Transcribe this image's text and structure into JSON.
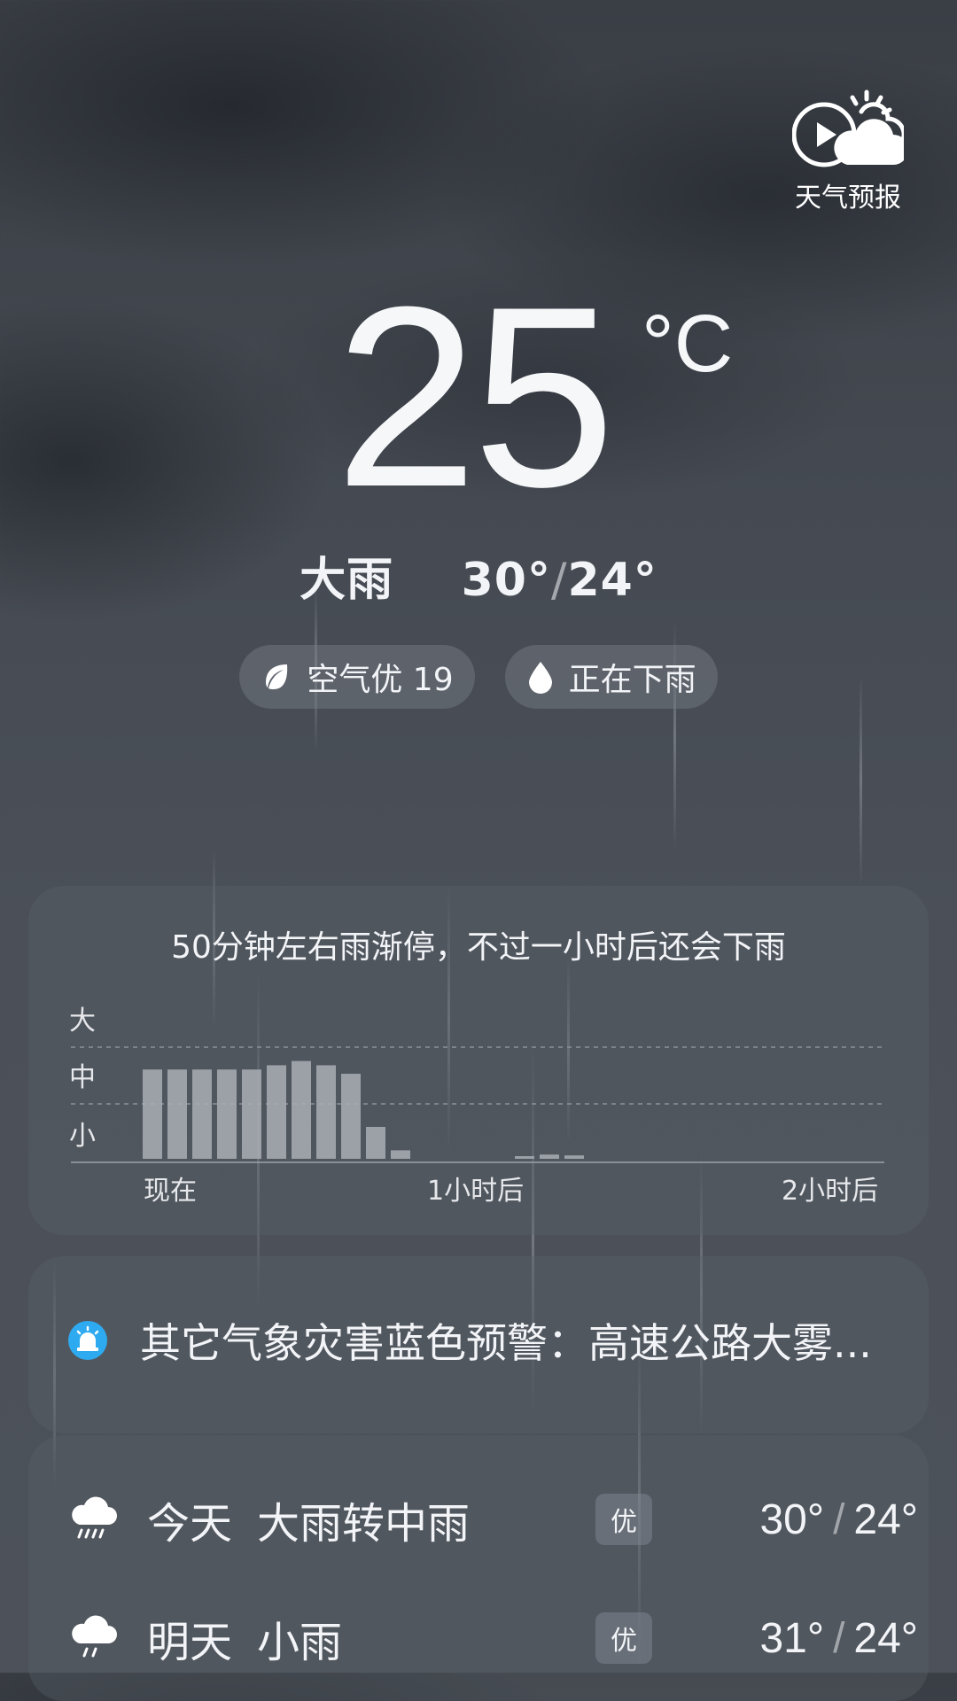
{
  "brand": {
    "label": "天气预报"
  },
  "current": {
    "temperature": "25",
    "unit": "°C",
    "condition": "大雨",
    "high": "30°",
    "low": "24°",
    "separator": "/"
  },
  "pills": [
    {
      "icon": "leaf-icon",
      "label": "空气优 19"
    },
    {
      "icon": "raindrop-icon",
      "label": "正在下雨"
    }
  ],
  "nowcast": {
    "summary": "50分钟左右雨渐停，不过一小时后还会下雨",
    "chart_data": {
      "type": "bar",
      "title": "",
      "y_levels": [
        "大",
        "中",
        "小"
      ],
      "x_ticks": [
        "现在",
        "1小时后",
        "2小时后"
      ],
      "ylim": [
        0,
        3
      ],
      "values": [
        2.1,
        2.1,
        2.1,
        2.1,
        2.1,
        2.2,
        2.3,
        2.2,
        2.0,
        0.75,
        0.2,
        0,
        0,
        0,
        0,
        0.05,
        0.1,
        0.08,
        0,
        0,
        0,
        0,
        0,
        0,
        0,
        0,
        0,
        0,
        0,
        0
      ],
      "grid": true
    }
  },
  "alert": {
    "icon": "alarm-icon",
    "text": "其它气象灾害蓝色预警：高速公路大雾..."
  },
  "forecast": [
    {
      "day": "今天",
      "condition": "大雨转中雨",
      "aqi": "优",
      "high": "30°",
      "low": "24°",
      "icon": "heavy-rain-icon"
    },
    {
      "day": "明天",
      "condition": "小雨",
      "aqi": "优",
      "high": "31°",
      "low": "24°",
      "icon": "light-rain-icon"
    }
  ],
  "colors": {
    "accent": "#2eaaf0",
    "bar": "#a9adb4",
    "grid": "#8d929a"
  }
}
